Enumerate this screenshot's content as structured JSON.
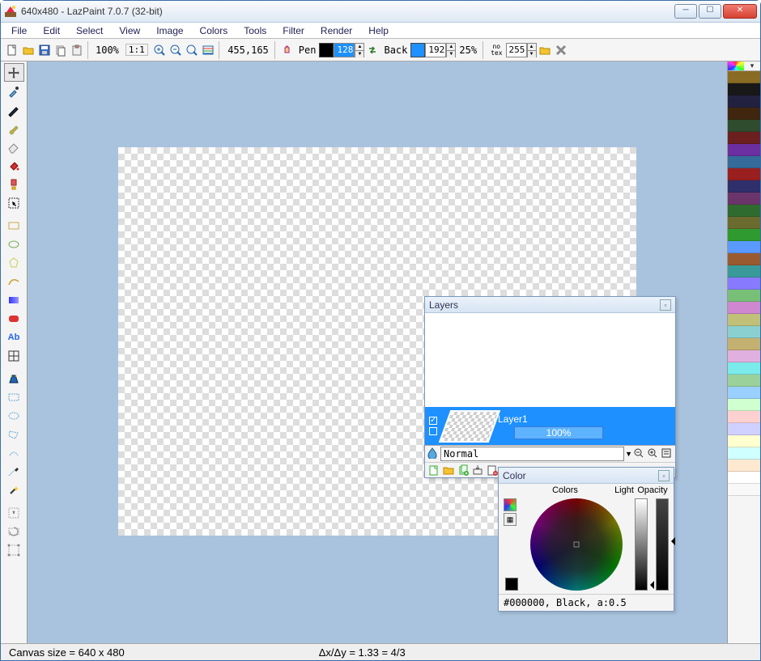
{
  "window": {
    "title": "640x480 - LazPaint 7.0.7 (32-bit)"
  },
  "menu": [
    "File",
    "Edit",
    "Select",
    "View",
    "Image",
    "Colors",
    "Tools",
    "Filter",
    "Render",
    "Help"
  ],
  "toolbar": {
    "zoom": "100%",
    "zoom_fit": "1:1",
    "coords": "455,165",
    "cursor_label": "Pen",
    "pen_width": "128",
    "back_label": "Back",
    "back_width": "192",
    "tolerance": "25%",
    "notex_label": "no\ntex",
    "opacity": "255"
  },
  "layers_panel": {
    "title": "Layers",
    "layer_name": "Layer1",
    "layer_opacity": "100%",
    "blend_mode": "Normal"
  },
  "color_panel": {
    "title": "Color",
    "colors_label": "Colors",
    "light_label": "Light",
    "opacity_label": "Opacity",
    "status": "#000000, Black, a:0.5"
  },
  "palette": [
    "#8a6b24",
    "#181818",
    "#222240",
    "#40260f",
    "#2f4c2f",
    "#6b1f1f",
    "#6b2fa1",
    "#356b9a",
    "#9a1f1f",
    "#2f2f6b",
    "#6b356b",
    "#2f6b2f",
    "#6b6b2f",
    "#2f9a2f",
    "#5a9aff",
    "#9a5a2f",
    "#3a9a9a",
    "#887aff",
    "#78c078",
    "#cf87cf",
    "#c0c078",
    "#8ad0d0",
    "#c4b070",
    "#e0b0e0",
    "#7aeaea",
    "#9ad09a",
    "#9ad0ff",
    "#d0ffd0",
    "#ffd0d0",
    "#d0d0ff",
    "#ffffd0",
    "#d0ffff",
    "#ffe8d0",
    "#ffffff",
    "#f8f8f8"
  ],
  "status": {
    "left": "Canvas size = 640 x 480",
    "right": "Δx/Δy = 1.33 = 4/3"
  }
}
